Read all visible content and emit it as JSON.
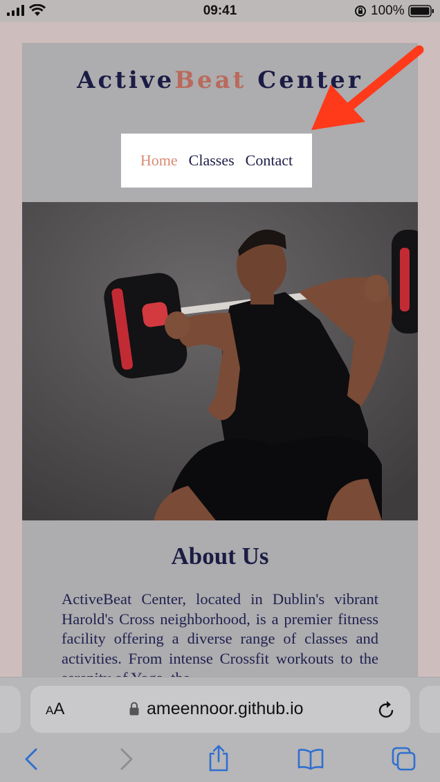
{
  "status_bar": {
    "time": "09:41",
    "battery": "100%"
  },
  "site": {
    "title_part1": "Active",
    "title_accent": "Beat",
    "title_part2": "Center",
    "nav": [
      {
        "label": "Home",
        "active": true
      },
      {
        "label": "Classes"
      },
      {
        "label": "Contact"
      }
    ]
  },
  "about": {
    "heading": "About Us",
    "body": "ActiveBeat Center, located in Dublin's vibrant Harold's Cross neighborhood, is a premier fitness facility offering a diverse range of classes and activities. From intense Crossfit workouts to the serenity of Yoga, the"
  },
  "browser": {
    "aa_label_small": "A",
    "aa_label_large": "A",
    "url": "ameennoor.github.io"
  },
  "colors": {
    "accent": "#b96a5c",
    "title_navy": "#1b1c45",
    "annotation_arrow": "#ff3a1a"
  }
}
